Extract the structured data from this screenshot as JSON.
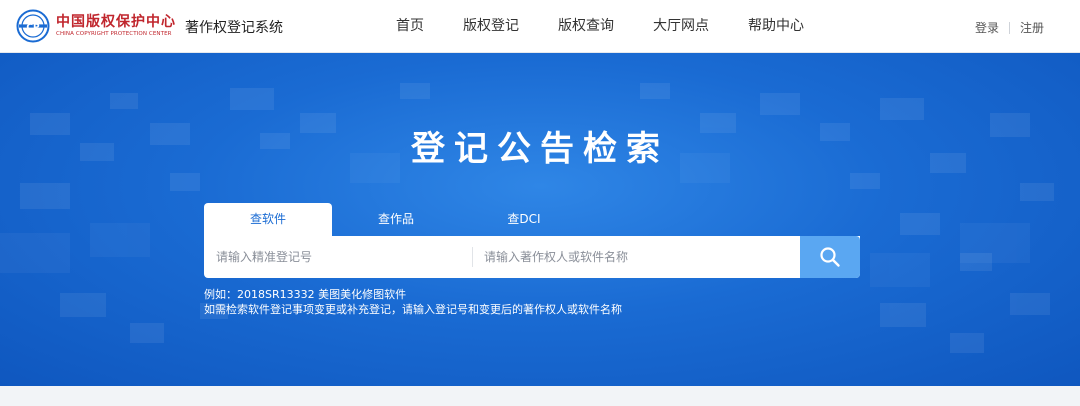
{
  "brand": {
    "name_cn": "中国版权保护中心",
    "name_en": "CHINA COPYRIGHT PROTECTION CENTER",
    "logo_letters": "CP",
    "system_title": "著作权登记系统",
    "colors": {
      "brand_red": "#c0262d",
      "primary_blue": "#1a6bd3",
      "button_blue": "#5aa7f2"
    }
  },
  "nav": {
    "items": [
      {
        "label": "首页"
      },
      {
        "label": "版权登记"
      },
      {
        "label": "版权查询"
      },
      {
        "label": "大厅网点"
      },
      {
        "label": "帮助中心"
      }
    ]
  },
  "auth": {
    "login": "登录",
    "register": "注册"
  },
  "hero": {
    "title": "登记公告检索",
    "tabs": [
      {
        "label": "查软件",
        "active": true
      },
      {
        "label": "查作品",
        "active": false
      },
      {
        "label": "查DCI",
        "active": false
      }
    ],
    "search": {
      "reg_no_value": "",
      "reg_no_placeholder": "请输入精准登记号",
      "name_value": "",
      "name_placeholder": "请输入著作权人或软件名称",
      "button_icon": "search-icon"
    },
    "hint_example": "例如：2018SR13332 美图美化修图软件",
    "hint_note": "如需检索软件登记事项变更或补充登记，请输入登记号和变更后的著作权人或软件名称"
  }
}
